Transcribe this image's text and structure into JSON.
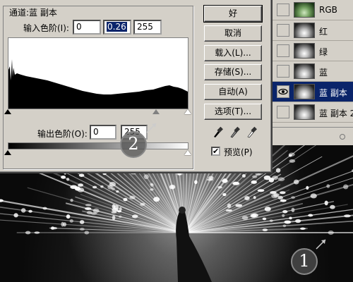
{
  "levels_dialog": {
    "channel_label": "通道:蓝 副本",
    "input_levels_label": "输入色阶(I):",
    "input_levels_underline": "I",
    "input_values": [
      "0",
      "0.26",
      "255"
    ],
    "output_levels_label": "输出色阶(O):",
    "output_values": [
      "0",
      "255"
    ],
    "buttons": {
      "ok": "好",
      "cancel": "取消",
      "load": "载入(L)...",
      "save": "存储(S)...",
      "auto": "自动(A)",
      "options": "选项(T)..."
    },
    "preview_label": "预览(P)",
    "preview_checked": true,
    "check_mark": "✔"
  },
  "layers_panel": {
    "rows": [
      {
        "label": "RGB",
        "selected": false,
        "visible": false
      },
      {
        "label": "红",
        "selected": false,
        "visible": false
      },
      {
        "label": "绿",
        "selected": false,
        "visible": false
      },
      {
        "label": "蓝",
        "selected": false,
        "visible": false
      },
      {
        "label": "蓝 副本",
        "selected": true,
        "visible": true
      },
      {
        "label": "蓝 副本 2",
        "selected": false,
        "visible": false
      }
    ]
  },
  "callouts": [
    "1",
    "2"
  ],
  "colors": {
    "dialog_bg": "#d4d0c8",
    "selection": "#0a246a"
  }
}
